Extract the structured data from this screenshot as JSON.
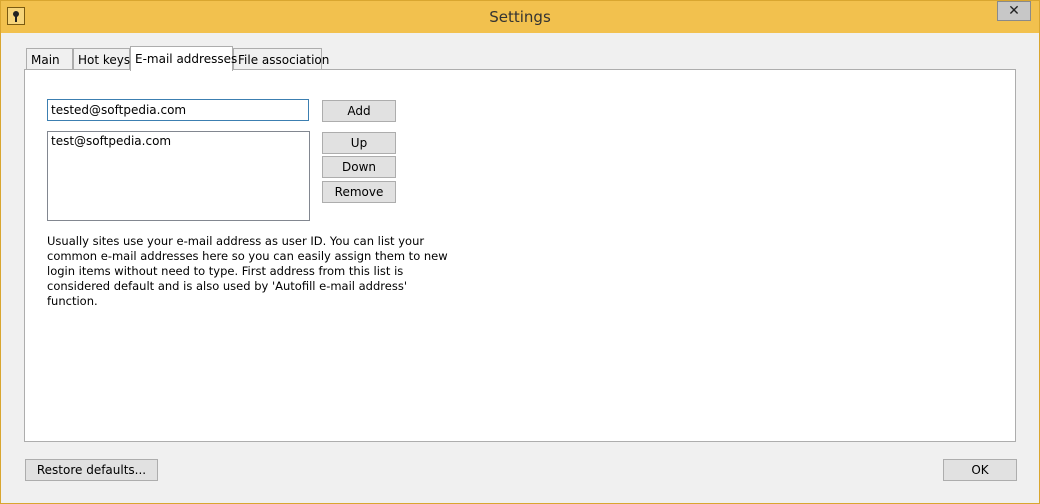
{
  "window": {
    "title": "Settings",
    "close_glyph": "✕",
    "app_icon": "keyhole-icon"
  },
  "tabs": [
    {
      "label": "Main"
    },
    {
      "label": "Hot keys"
    },
    {
      "label": "E-mail addresses"
    },
    {
      "label": "File association"
    }
  ],
  "active_tab": "E-mail addresses",
  "email_panel": {
    "input_value": "tested@softpedia.com",
    "list": [
      "test@softpedia.com"
    ],
    "buttons": {
      "add": "Add",
      "up": "Up",
      "down": "Down",
      "remove": "Remove"
    },
    "help_text": "Usually sites use your e-mail address as user ID. You can list your common e-mail addresses here so you can easily assign them to new login items without need to type. First address from this list is considered default and is also used by 'Autofill e-mail address' function."
  },
  "footer": {
    "restore_label": "Restore defaults...",
    "ok_label": "OK"
  }
}
